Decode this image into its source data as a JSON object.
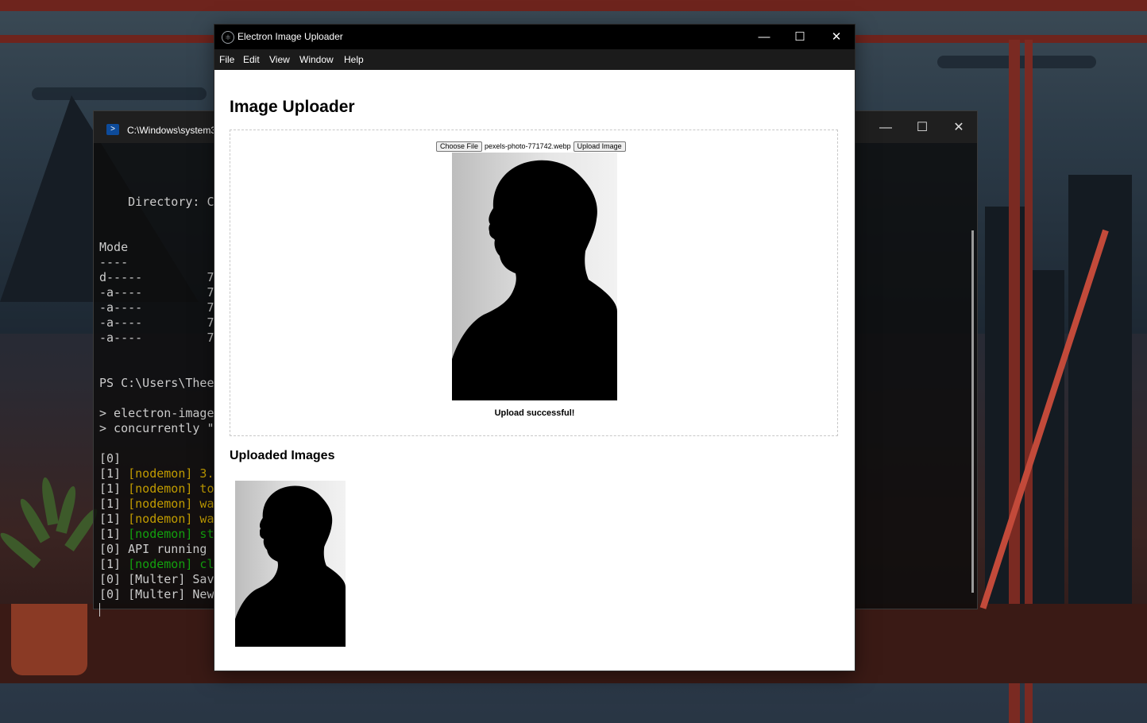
{
  "terminal": {
    "title": "C:\\Windows\\system3",
    "controls": [
      "—",
      "☐",
      "✕"
    ],
    "lines": [
      {
        "text": "",
        "color": "default"
      },
      {
        "text": "    Directory: C",
        "color": "default"
      },
      {
        "text": "",
        "color": "default"
      },
      {
        "text": "",
        "color": "default"
      },
      {
        "text": "Mode",
        "color": "default"
      },
      {
        "text": "----",
        "color": "default"
      },
      {
        "text": "d-----         7",
        "color": "default"
      },
      {
        "text": "-a----         7",
        "color": "default"
      },
      {
        "text": "-a----         7",
        "color": "default"
      },
      {
        "text": "-a----         7",
        "color": "default"
      },
      {
        "text": "-a----         7",
        "color": "default"
      },
      {
        "text": "",
        "color": "default"
      },
      {
        "text": "",
        "color": "default"
      },
      {
        "text": "PS C:\\Users\\Thee",
        "color": "default"
      },
      {
        "text": "",
        "color": "default"
      },
      {
        "text": "> electron-image",
        "color": "default"
      },
      {
        "text": "> concurrently \"",
        "color": "default"
      },
      {
        "text": "",
        "color": "default"
      },
      {
        "text": "[0]",
        "color": "default"
      },
      {
        "text": "[1] ",
        "color": "default",
        "colored": "[nodemon] 3.",
        "ccolor": "yellow"
      },
      {
        "text": "[1] ",
        "color": "default",
        "colored": "[nodemon] to",
        "ccolor": "yellow"
      },
      {
        "text": "[1] ",
        "color": "default",
        "colored": "[nodemon] wa",
        "ccolor": "yellow"
      },
      {
        "text": "[1] ",
        "color": "default",
        "colored": "[nodemon] wa",
        "ccolor": "yellow"
      },
      {
        "text": "[1] ",
        "color": "default",
        "colored": "[nodemon] st",
        "ccolor": "green"
      },
      {
        "text": "[0] API running ",
        "color": "default"
      },
      {
        "text": "[1] ",
        "color": "default",
        "colored": "[nodemon] cl",
        "ccolor": "green"
      },
      {
        "text": "[0] [Multer] Sav",
        "color": "default"
      },
      {
        "text": "[0] [Multer] New",
        "color": "default"
      }
    ]
  },
  "window": {
    "title": "Electron Image Uploader",
    "controls": {
      "minimize": "—",
      "maximize": "☐",
      "close": "✕"
    }
  },
  "menu": [
    "File",
    "Edit",
    "View",
    "Window",
    "Help"
  ],
  "page": {
    "heading": "Image Uploader",
    "choose_file_label": "Choose File",
    "file_name": "pexels-photo-771742.webp",
    "upload_label": "Upload Image",
    "status": "Upload successful!",
    "uploaded_heading": "Uploaded Images"
  },
  "colors": {
    "terminal_yellow": "#c19c00",
    "terminal_green": "#13a10e",
    "titlebar": "#000000",
    "menubar": "#1b1b1b"
  },
  "icons": {
    "electron_app": "electron-icon",
    "powershell": "powershell-icon"
  }
}
